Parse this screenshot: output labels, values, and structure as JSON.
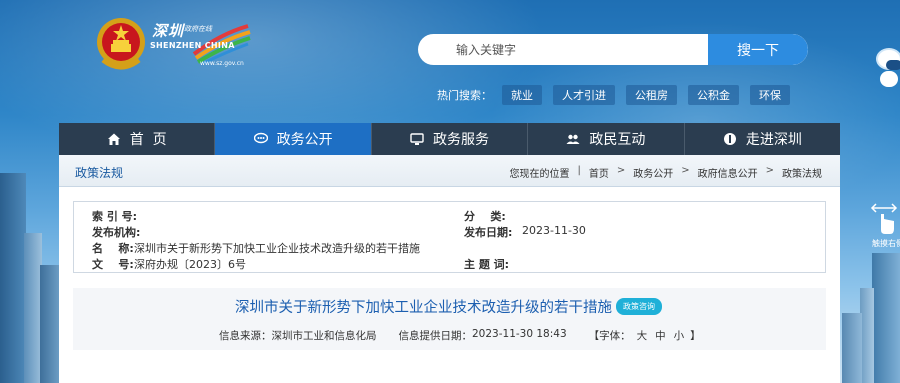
{
  "header": {
    "logo_cn": "深圳",
    "logo_cn_small": "政府在线",
    "logo_en": "SHENZHEN CHINA",
    "logo_url": "www.sz.gov.cn",
    "search": {
      "placeholder": "输入关键字",
      "button": "搜一下"
    },
    "hot_label": "热门搜索：",
    "hot_tags": [
      "就业",
      "人才引进",
      "公租房",
      "公积金",
      "环保"
    ],
    "side_hint": "触摸右侧"
  },
  "nav": {
    "items": [
      {
        "label": "首  页",
        "icon": "home-icon"
      },
      {
        "label": "政务公开",
        "icon": "chat-icon"
      },
      {
        "label": "政务服务",
        "icon": "monitor-icon"
      },
      {
        "label": "政民互动",
        "icon": "people-icon"
      },
      {
        "label": "走进深圳",
        "icon": "map-pin-icon"
      }
    ],
    "active_index": 1
  },
  "breadcrumb": {
    "section_title": "政策法规",
    "location_label": "您现在的位置",
    "items": [
      "首页",
      "政务公开",
      "政府信息公开",
      "政策法规"
    ],
    "separator": ">"
  },
  "meta": {
    "index_no_label": "索 引 号:",
    "index_no": "",
    "category_label": "分    类:",
    "category": "",
    "publisher_label": "发布机构:",
    "publisher": "",
    "publish_date_label": "发布日期:",
    "publish_date": "2023-11-30",
    "name_label": "名    称:",
    "name": "深圳市关于新形势下加快工业企业技术改造升级的若干措施",
    "doc_no_label": "文    号:",
    "doc_no": "深府办规〔2023〕6号",
    "subject_label": "主 题 词:",
    "subject": ""
  },
  "article": {
    "title": "深圳市关于新形势下加快工业企业技术改造升级的若干措施",
    "badge": "政策咨询",
    "source_label": "信息来源：",
    "source": "深圳市工业和信息化局",
    "date_label": "信息提供日期：",
    "date": "2023-11-30 18:43",
    "font_label": "【字体：",
    "font_large": "大",
    "font_medium": "中",
    "font_small": "小",
    "font_close": "】"
  },
  "colors": {
    "nav_bg": "#2b3d50",
    "nav_active": "#1e6fc4",
    "search_button": "#2d8ce0",
    "title_blue": "#1c5fb0",
    "badge": "#1fb0d8"
  }
}
